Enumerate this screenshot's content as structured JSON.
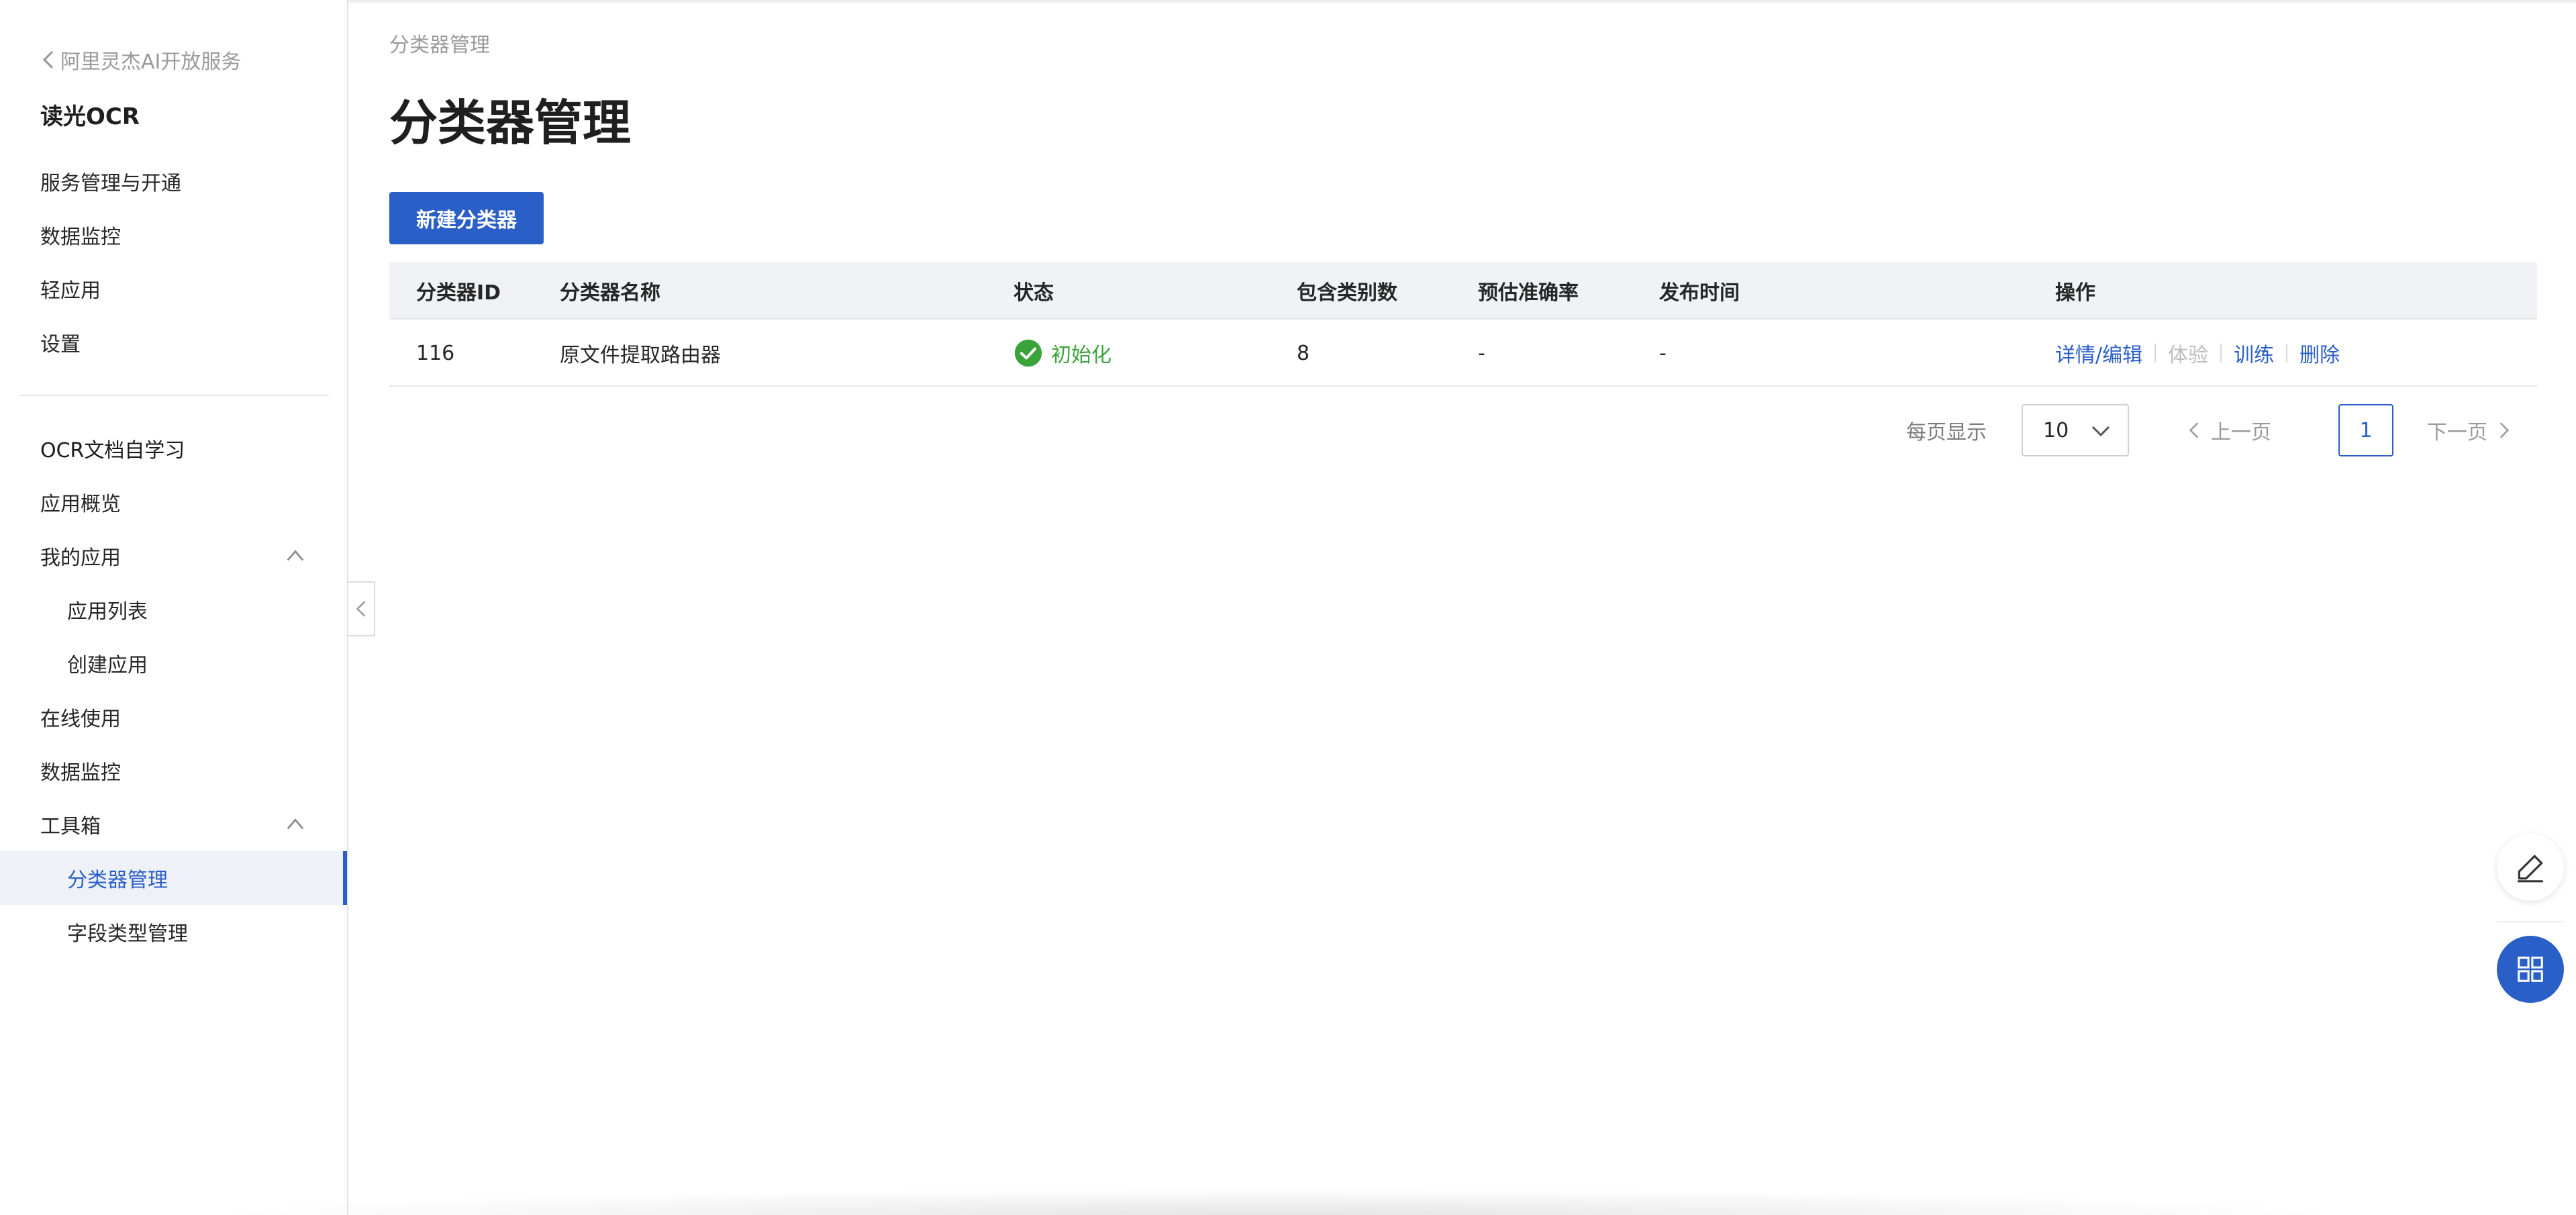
{
  "sidebar": {
    "back_link": "阿里灵杰AI开放服务",
    "product_title": "读光OCR",
    "items": [
      {
        "label": "服务管理与开通"
      },
      {
        "label": "数据监控"
      },
      {
        "label": "轻应用"
      },
      {
        "label": "设置"
      }
    ],
    "section_title": "OCR文档自学习",
    "section_items": [
      {
        "label": "应用概览"
      },
      {
        "label": "我的应用"
      },
      {
        "label": "应用列表"
      },
      {
        "label": "创建应用"
      },
      {
        "label": "在线使用"
      },
      {
        "label": "数据监控"
      },
      {
        "label": "工具箱"
      },
      {
        "label": "分类器管理"
      },
      {
        "label": "字段类型管理"
      }
    ]
  },
  "breadcrumb": "分类器管理",
  "page_title": "分类器管理",
  "new_button_label": "新建分类器",
  "table": {
    "columns": [
      "分类器ID",
      "分类器名称",
      "状态",
      "包含类别数",
      "预估准确率",
      "发布时间",
      "操作"
    ],
    "rows": [
      {
        "id": "116",
        "name": "原文件提取路由器",
        "status": "初始化",
        "category_count": "8",
        "accuracy": "-",
        "publish_time": "-",
        "actions": [
          "详情/编辑",
          "体验",
          "训练",
          "删除"
        ]
      }
    ]
  },
  "pagination": {
    "per_page_label": "每页显示",
    "per_page_value": "10",
    "prev_label": "上一页",
    "current_page": "1",
    "next_label": "下一页"
  },
  "colors": {
    "primary": "#2a5fc8",
    "success": "#3aa33a",
    "accent_top": "#e0533d"
  }
}
